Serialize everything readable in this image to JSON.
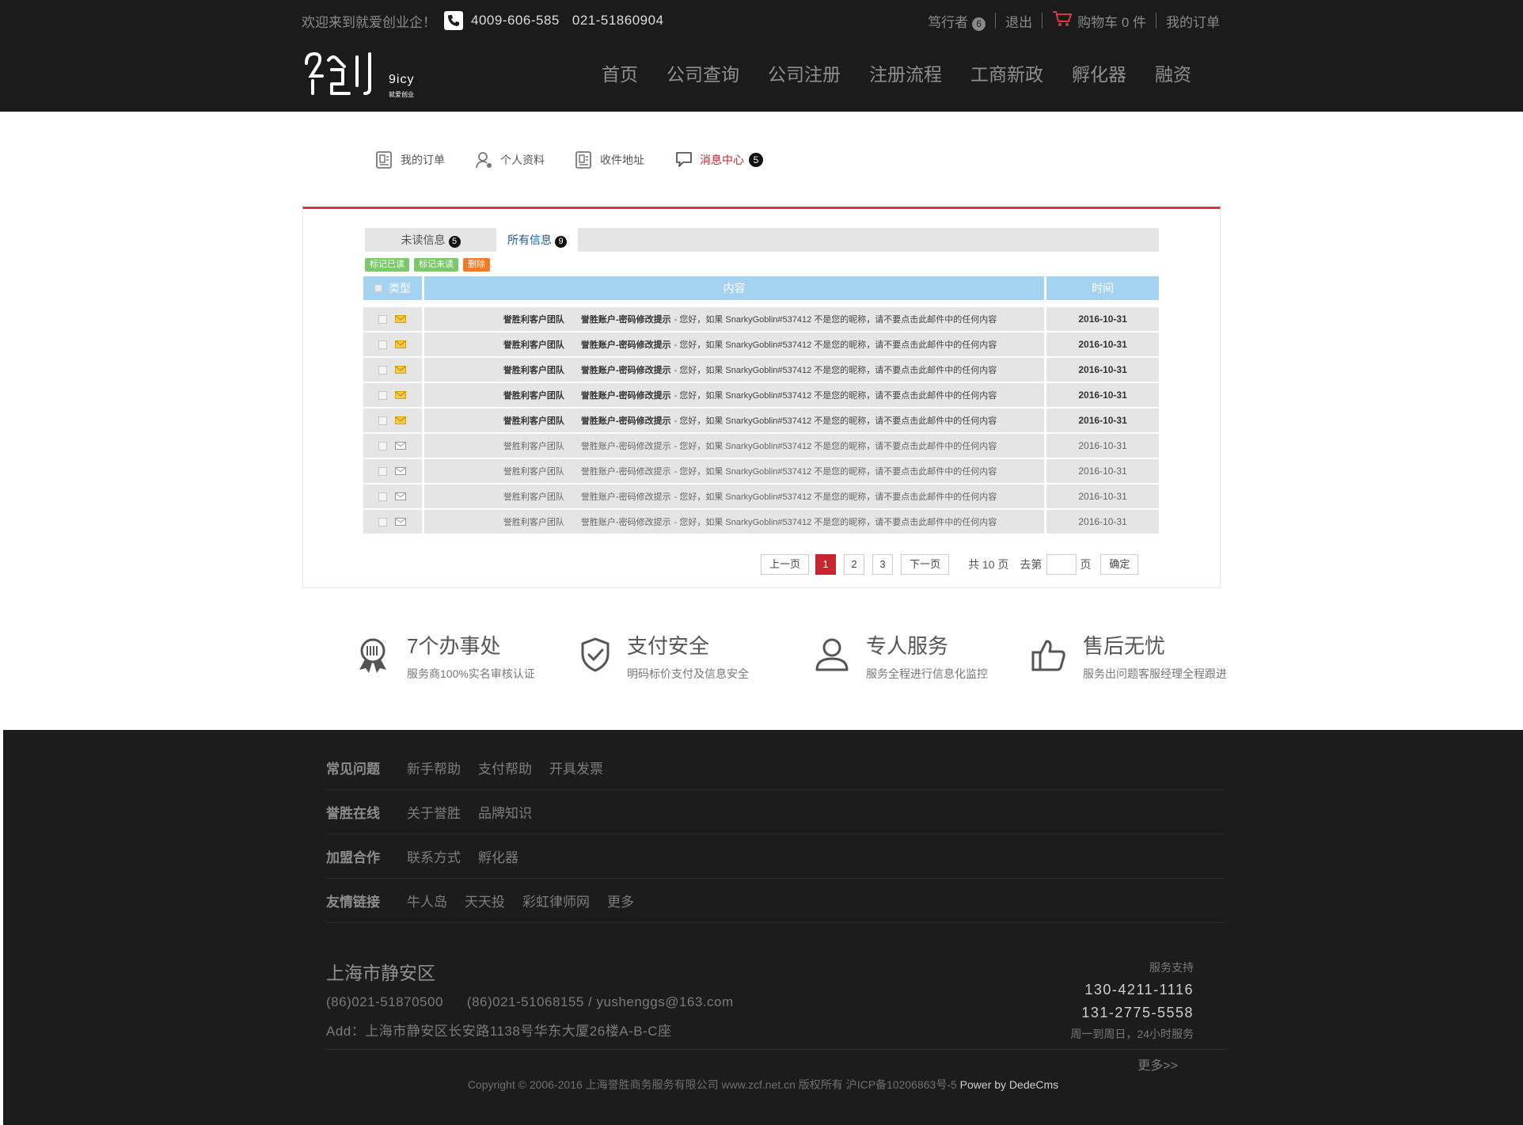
{
  "topbar": {
    "welcome": "欢迎来到就爱创业企！",
    "phone1": "4009-606-585",
    "phone2": "021-51860904",
    "user": "笃行者",
    "user_badge": "6",
    "logout": "退出",
    "cart": "购物车 0 件",
    "my_orders": "我的订单"
  },
  "logo": {
    "brand": "9icy",
    "tagline": "就爱创业"
  },
  "nav": [
    "首页",
    "公司查询",
    "公司注册",
    "注册流程",
    "工商新政",
    "孵化器",
    "融资"
  ],
  "usertabs": {
    "orders": "我的订单",
    "profile": "个人资料",
    "address": "收件地址",
    "messages": "消息中心",
    "messages_badge": "5"
  },
  "msgtabs": {
    "unread": "未读信息",
    "unread_badge": "5",
    "all": "所有信息",
    "all_badge": "9"
  },
  "actions": {
    "mark_read": "标记已读",
    "mark_unread": "标记未读",
    "delete": "删除"
  },
  "table": {
    "headers": {
      "type": "类型",
      "content": "内容",
      "time": "时间"
    },
    "rows": [
      {
        "team": "誉胜利客户团队",
        "subject": "誉胜账户-密码修改提示",
        "body": "- 您好，如果 SnarkyGoblin#537412 不是您的昵称，请不要点击此邮件中的任何内容",
        "date": "2016-10-31"
      },
      {
        "team": "誉胜利客户团队",
        "subject": "誉胜账户-密码修改提示",
        "body": "- 您好，如果 SnarkyGoblin#537412 不是您的昵称，请不要点击此邮件中的任何内容",
        "date": "2016-10-31"
      },
      {
        "team": "誉胜利客户团队",
        "subject": "誉胜账户-密码修改提示",
        "body": "- 您好，如果 SnarkyGoblin#537412 不是您的昵称，请不要点击此邮件中的任何内容",
        "date": "2016-10-31"
      },
      {
        "team": "誉胜利客户团队",
        "subject": "誉胜账户-密码修改提示",
        "body": "- 您好，如果 SnarkyGoblin#537412 不是您的昵称，请不要点击此邮件中的任何内容",
        "date": "2016-10-31"
      },
      {
        "team": "誉胜利客户团队",
        "subject": "誉胜账户-密码修改提示",
        "body": "- 您好，如果 SnarkyGoblin#537412 不是您的昵称，请不要点击此邮件中的任何内容",
        "date": "2016-10-31"
      },
      {
        "team": "誉胜利客户团队",
        "subject": "誉胜账户-密码修改提示",
        "body": "- 您好，如果 SnarkyGoblin#537412 不是您的昵称，请不要点击此邮件中的任何内容",
        "date": "2016-10-31"
      },
      {
        "team": "誉胜利客户团队",
        "subject": "誉胜账户-密码修改提示",
        "body": "- 您好，如果 SnarkyGoblin#537412 不是您的昵称，请不要点击此邮件中的任何内容",
        "date": "2016-10-31"
      },
      {
        "team": "誉胜利客户团队",
        "subject": "誉胜账户-密码修改提示",
        "body": "- 您好，如果 SnarkyGoblin#537412 不是您的昵称，请不要点击此邮件中的任何内容",
        "date": "2016-10-31"
      },
      {
        "team": "誉胜利客户团队",
        "subject": "誉胜账户-密码修改提示",
        "body": "- 您好，如果 SnarkyGoblin#537412 不是您的昵称，请不要点击此邮件中的任何内容",
        "date": "2016-10-31"
      }
    ]
  },
  "pager": {
    "prev": "上一页",
    "pages": [
      "1",
      "2",
      "3"
    ],
    "next": "下一页",
    "total": "共 10 页",
    "goto": "去第",
    "page_unit": "页",
    "confirm": "确定"
  },
  "features": [
    {
      "icon": "ribbon-award-icon",
      "title": "7个办事处",
      "desc": "服务商100%实名审核认证"
    },
    {
      "icon": "shield-check-icon",
      "title": "支付安全",
      "desc": "明码标价支付及信息安全"
    },
    {
      "icon": "user-icon",
      "title": "专人服务",
      "desc": "服务全程进行信息化监控"
    },
    {
      "icon": "thumbs-up-icon",
      "title": "售后无忧",
      "desc": "服务出问题客服经理全程跟进"
    }
  ],
  "footer": {
    "rows": [
      {
        "heading": "常见问题",
        "links": [
          "新手帮助",
          "支付帮助",
          "开具发票"
        ]
      },
      {
        "heading": "誉胜在线",
        "links": [
          "关于誉胜",
          "品牌知识"
        ]
      },
      {
        "heading": "加盟合作",
        "links": [
          "联系方式",
          "孵化器"
        ]
      },
      {
        "heading": "友情链接",
        "links": [
          "牛人岛",
          "天天投",
          "彩虹律师网",
          "更多"
        ]
      }
    ],
    "city": "上海市静安区",
    "tel1": "(86)021-51870500",
    "tel2": "(86)021-51068155 / yushenggs@163.com",
    "address": "Add：上海市静安区长安路1138号华东大厦26楼A-B-C座",
    "support_label": "服务支持",
    "support1": "130-4211-1116",
    "support2": "131-2775-5558",
    "support_hours": "周一到周日，24小时服务",
    "more": "更多>>",
    "copyright": "Copyright © 2006-2016 上海誉胜商务服务有限公司 www.zcf.net.cn  版权所有  沪ICP备10206863号-5 ",
    "power": "Power by DedeCms"
  },
  "colors": {
    "accent": "#c8262e",
    "header_bg": "#1b1b1b",
    "table_head": "#a4d2f1",
    "unread_icon": "#f0b400"
  }
}
